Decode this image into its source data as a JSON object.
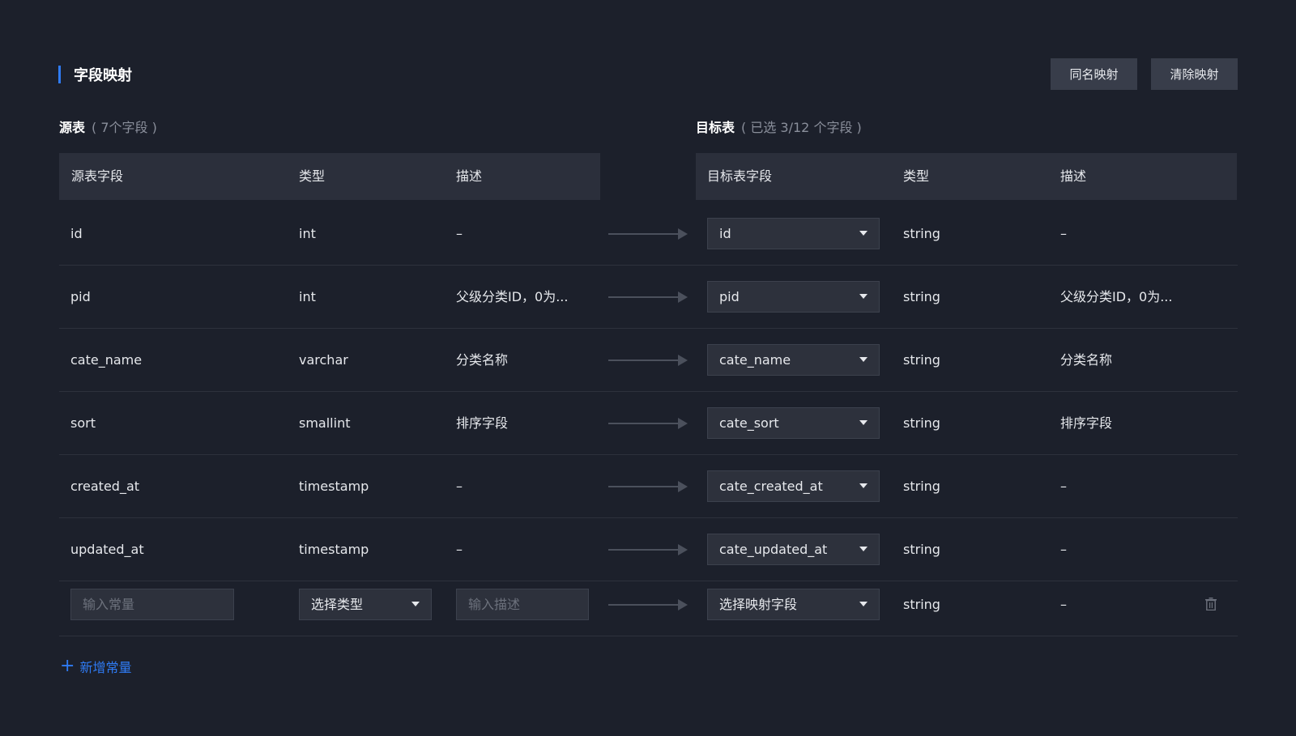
{
  "header": {
    "title": "字段映射",
    "buttons": {
      "same_name": "同名映射",
      "clear": "清除映射"
    }
  },
  "source_table": {
    "label": "源表",
    "count_text": "( 7个字段 )",
    "columns": [
      "源表字段",
      "类型",
      "描述"
    ]
  },
  "target_table": {
    "label": "目标表",
    "count_text": "( 已选 3/12 个字段 )",
    "columns": [
      "目标表字段",
      "类型",
      "描述"
    ]
  },
  "rows": [
    {
      "src_field": "id",
      "src_type": "int",
      "src_desc": "–",
      "mapped": "id",
      "dst_type": "string",
      "dst_desc": "–"
    },
    {
      "src_field": "pid",
      "src_type": "int",
      "src_desc": "父级分类ID，0为...",
      "mapped": "pid",
      "dst_type": "string",
      "dst_desc": "父级分类ID，0为..."
    },
    {
      "src_field": "cate_name",
      "src_type": "varchar",
      "src_desc": "分类名称",
      "mapped": "cate_name",
      "dst_type": "string",
      "dst_desc": "分类名称"
    },
    {
      "src_field": "sort",
      "src_type": "smallint",
      "src_desc": "排序字段",
      "mapped": "cate_sort",
      "dst_type": "string",
      "dst_desc": "排序字段"
    },
    {
      "src_field": "created_at",
      "src_type": "timestamp",
      "src_desc": "–",
      "mapped": "cate_created_at",
      "dst_type": "string",
      "dst_desc": "–"
    },
    {
      "src_field": "updated_at",
      "src_type": "timestamp",
      "src_desc": "–",
      "mapped": "cate_updated_at",
      "dst_type": "string",
      "dst_desc": "–"
    }
  ],
  "constant_row": {
    "const_placeholder": "输入常量",
    "type_select": "选择类型",
    "desc_placeholder": "输入描述",
    "mapped_select": "选择映射字段",
    "dst_type": "string",
    "dst_desc": "–"
  },
  "add_constant_label": "新增常量",
  "icons": {
    "dropdown": "caret-down-icon",
    "delete": "trash-icon",
    "add": "plus-icon",
    "mapping": "arrow-right-icon"
  },
  "colors": {
    "accent": "#2f7bf4",
    "background": "#1c202b",
    "header_bg": "#2b2f3b",
    "button_bg": "#383d4a"
  }
}
